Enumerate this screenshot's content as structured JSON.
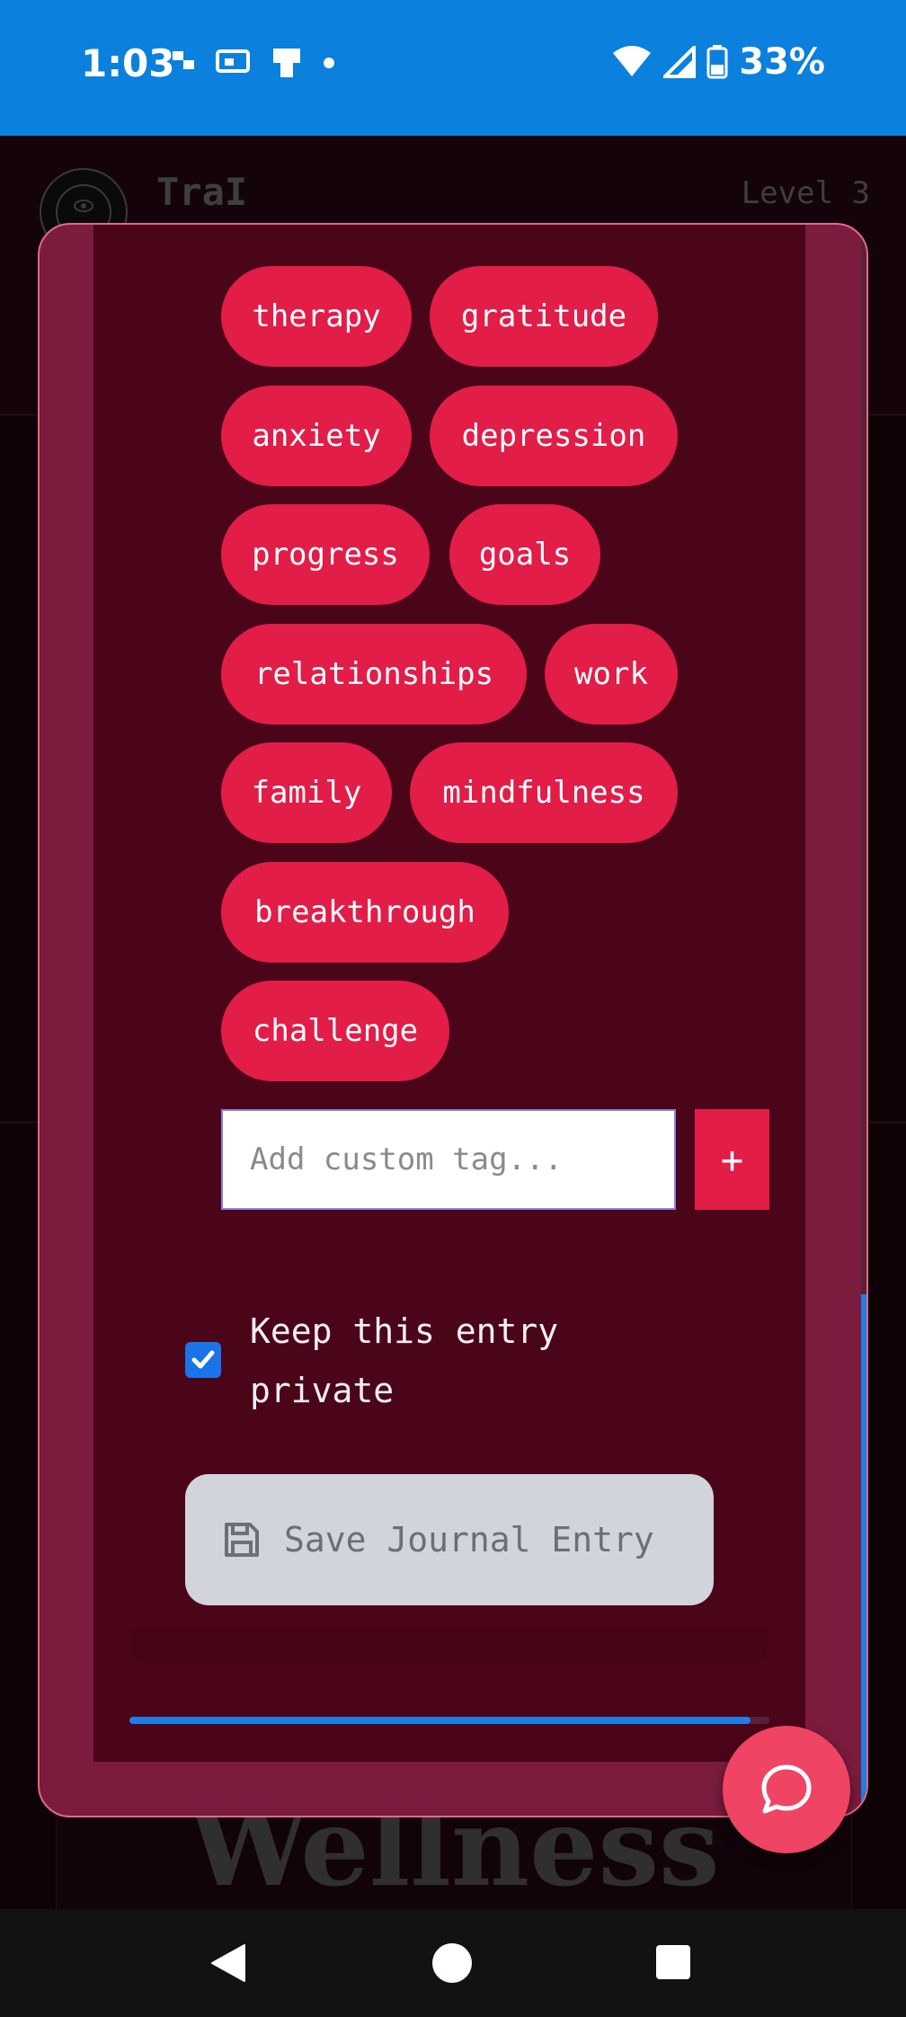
{
  "status_bar": {
    "time": "1:03",
    "battery": "33%",
    "icons": [
      "notification-icon",
      "wifi-icon",
      "cell-signal-icon",
      "battery-icon"
    ]
  },
  "app_header": {
    "title": "TraI",
    "level": "Level 3"
  },
  "modal": {
    "tags": [
      "therapy",
      "gratitude",
      "anxiety",
      "depression",
      "progress",
      "goals",
      "relationships",
      "work",
      "family",
      "mindfulness",
      "breakthrough",
      "challenge"
    ],
    "custom_tag_placeholder": "Add custom tag...",
    "add_tag_label": "+",
    "private_label": "Keep this entry private",
    "private_checked": true,
    "save_label": "Save Journal Entry",
    "scroll_progress": 0.97
  },
  "background": {
    "wellness_title": "Wellness"
  },
  "colors": {
    "accent": "#e11d48",
    "status_bar": "#0b80dc",
    "modal": "#7b1c3e",
    "modal_inner": "#4b0519"
  }
}
